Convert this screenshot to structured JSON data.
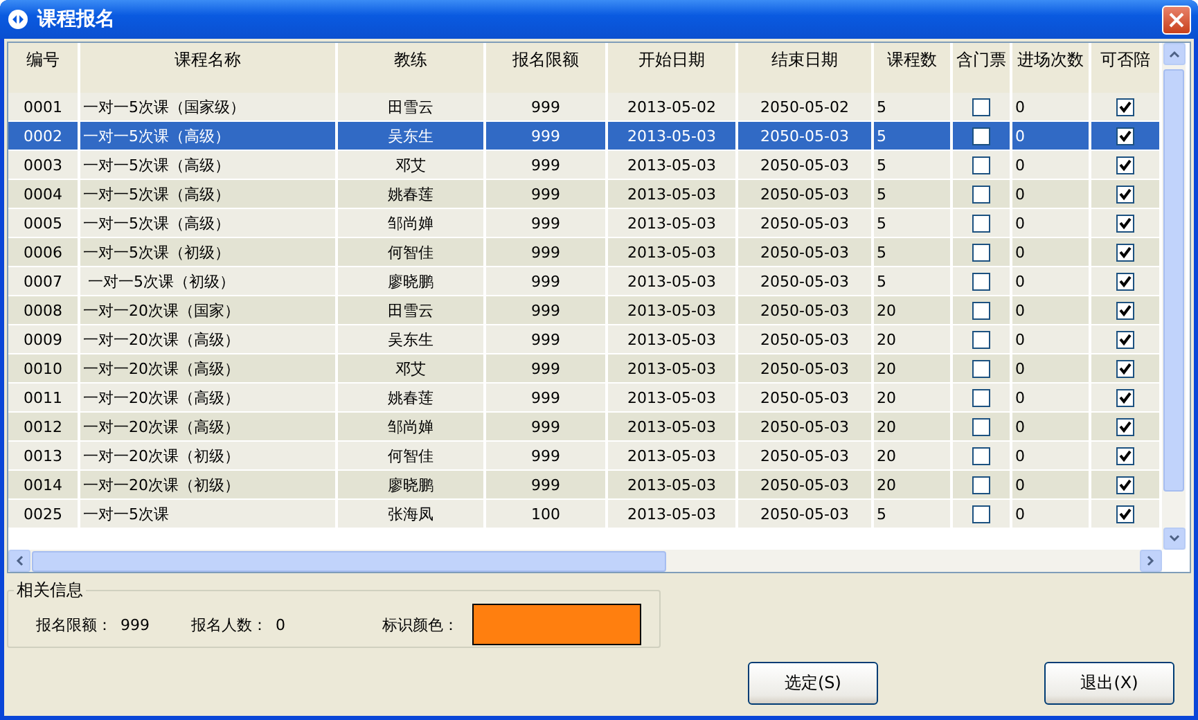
{
  "window": {
    "title": "课程报名"
  },
  "table": {
    "columns": [
      "编号",
      "课程名称",
      "教练",
      "报名限额",
      "开始日期",
      "结束日期",
      "课程数",
      "含门票",
      "进场次数",
      "可否陪"
    ],
    "rows": [
      {
        "id": "0001",
        "name": "一对一5次课（国家级）",
        "coach": "田雪云",
        "limit": "999",
        "start": "2013-05-02",
        "end": "2050-05-02",
        "lessons": "5",
        "ticket": false,
        "entries": "0",
        "companion": true,
        "selected": false
      },
      {
        "id": "0002",
        "name": "一对一5次课（高级）",
        "coach": "吴东生",
        "limit": "999",
        "start": "2013-05-03",
        "end": "2050-05-03",
        "lessons": "5",
        "ticket": false,
        "entries": "0",
        "companion": true,
        "selected": true
      },
      {
        "id": "0003",
        "name": "一对一5次课（高级）",
        "coach": "邓艾",
        "limit": "999",
        "start": "2013-05-03",
        "end": "2050-05-03",
        "lessons": "5",
        "ticket": false,
        "entries": "0",
        "companion": true,
        "selected": false
      },
      {
        "id": "0004",
        "name": "一对一5次课（高级）",
        "coach": "姚春莲",
        "limit": "999",
        "start": "2013-05-03",
        "end": "2050-05-03",
        "lessons": "5",
        "ticket": false,
        "entries": "0",
        "companion": true,
        "selected": false
      },
      {
        "id": "0005",
        "name": "一对一5次课（高级）",
        "coach": "邹尚婵",
        "limit": "999",
        "start": "2013-05-03",
        "end": "2050-05-03",
        "lessons": "5",
        "ticket": false,
        "entries": "0",
        "companion": true,
        "selected": false
      },
      {
        "id": "0006",
        "name": "一对一5次课（初级）",
        "coach": "何智佳",
        "limit": "999",
        "start": "2013-05-03",
        "end": "2050-05-03",
        "lessons": "5",
        "ticket": false,
        "entries": "0",
        "companion": true,
        "selected": false
      },
      {
        "id": "0007",
        "name": " 一对一5次课（初级）",
        "coach": "廖晓鹏",
        "limit": "999",
        "start": "2013-05-03",
        "end": "2050-05-03",
        "lessons": "5",
        "ticket": false,
        "entries": "0",
        "companion": true,
        "selected": false
      },
      {
        "id": "0008",
        "name": "一对一20次课（国家）",
        "coach": "田雪云",
        "limit": "999",
        "start": "2013-05-03",
        "end": "2050-05-03",
        "lessons": "20",
        "ticket": false,
        "entries": "0",
        "companion": true,
        "selected": false
      },
      {
        "id": "0009",
        "name": "一对一20次课（高级）",
        "coach": "吴东生",
        "limit": "999",
        "start": "2013-05-03",
        "end": "2050-05-03",
        "lessons": "20",
        "ticket": false,
        "entries": "0",
        "companion": true,
        "selected": false
      },
      {
        "id": "0010",
        "name": "一对一20次课（高级）",
        "coach": "邓艾",
        "limit": "999",
        "start": "2013-05-03",
        "end": "2050-05-03",
        "lessons": "20",
        "ticket": false,
        "entries": "0",
        "companion": true,
        "selected": false
      },
      {
        "id": "0011",
        "name": "一对一20次课（高级）",
        "coach": "姚春莲",
        "limit": "999",
        "start": "2013-05-03",
        "end": "2050-05-03",
        "lessons": "20",
        "ticket": false,
        "entries": "0",
        "companion": true,
        "selected": false
      },
      {
        "id": "0012",
        "name": "一对一20次课（高级）",
        "coach": "邹尚婵",
        "limit": "999",
        "start": "2013-05-03",
        "end": "2050-05-03",
        "lessons": "20",
        "ticket": false,
        "entries": "0",
        "companion": true,
        "selected": false
      },
      {
        "id": "0013",
        "name": "一对一20次课（初级）",
        "coach": "何智佳",
        "limit": "999",
        "start": "2013-05-03",
        "end": "2050-05-03",
        "lessons": "20",
        "ticket": false,
        "entries": "0",
        "companion": true,
        "selected": false
      },
      {
        "id": "0014",
        "name": "一对一20次课（初级）",
        "coach": "廖晓鹏",
        "limit": "999",
        "start": "2013-05-03",
        "end": "2050-05-03",
        "lessons": "20",
        "ticket": false,
        "entries": "0",
        "companion": true,
        "selected": false
      },
      {
        "id": "0025",
        "name": "一对一5次课",
        "coach": "张海凤",
        "limit": "100",
        "start": "2013-05-03",
        "end": "2050-05-03",
        "lessons": "5",
        "ticket": false,
        "entries": "0",
        "companion": true,
        "selected": false
      }
    ]
  },
  "info": {
    "title": "相关信息",
    "fields": [
      {
        "label": "报名限额：",
        "value": "999"
      },
      {
        "label": "报名人数：",
        "value": "0"
      }
    ],
    "color_label": "标识颜色：",
    "color": "#ff7f0f"
  },
  "buttons": [
    "选定(S)",
    "退出(X)"
  ]
}
